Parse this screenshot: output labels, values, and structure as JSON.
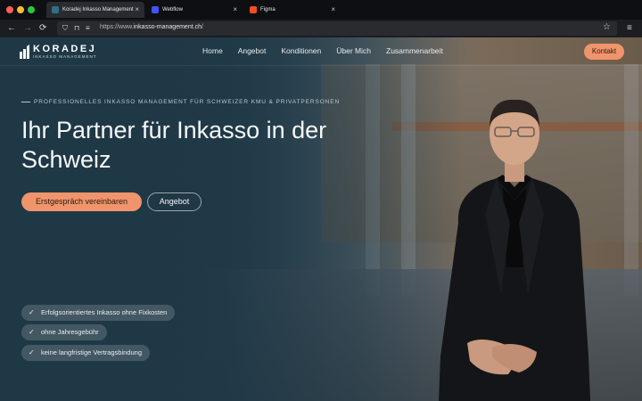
{
  "browser": {
    "tabs": [
      {
        "label": "Koradej Inkasso Management",
        "active": true,
        "favicon_color": "#2f6f86"
      },
      {
        "label": "Webflow",
        "active": false,
        "favicon_color": "#4353ff"
      },
      {
        "label": "Figma",
        "active": false,
        "favicon_color": "#f24e1e"
      }
    ],
    "url_prefix": "https://www.",
    "url_host": "inkasso-management.ch",
    "url_suffix": "/"
  },
  "nav": {
    "logo_name": "KORADEJ",
    "logo_sub": "INKASSO MANAGEMENT",
    "items": [
      "Home",
      "Angebot",
      "Konditionen",
      "Über Mich",
      "Zusammenarbeit"
    ],
    "cta": "Kontakt"
  },
  "hero": {
    "eyebrow": "Professionelles Inkasso Management für Schweizer KMU & Privatpersonen",
    "headline": "Ihr Partner für Inkasso in der Schweiz",
    "primary_button": "Erstgespräch vereinbaren",
    "secondary_button": "Angebot",
    "features": [
      "Erfolgsorientiertes Inkasso ohne Fixkosten",
      "ohne Jahresgebühr",
      "keine langfristige Vertragsbindung"
    ]
  },
  "colors": {
    "accent": "#f0956b",
    "overlay": "#1f3846"
  }
}
